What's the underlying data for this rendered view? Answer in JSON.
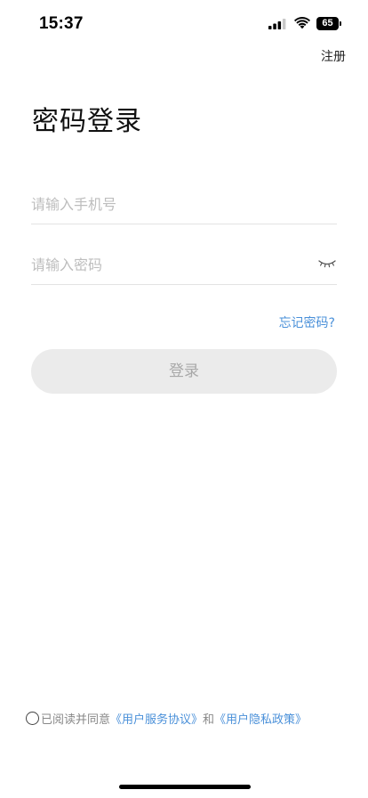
{
  "status_bar": {
    "time": "15:37",
    "battery_level": "65",
    "icons": [
      "signal-icon",
      "wifi-icon",
      "battery-icon"
    ]
  },
  "header": {
    "register_label": "注册"
  },
  "main": {
    "title": "密码登录",
    "phone_field": {
      "placeholder": "请输入手机号",
      "value": ""
    },
    "password_field": {
      "placeholder": "请输入密码",
      "value": "",
      "toggle_icon": "eye-closed-icon"
    },
    "forgot_password_label": "忘记密码?",
    "login_button_label": "登录"
  },
  "agreement": {
    "checked": false,
    "prefix": "已阅读并同意",
    "terms_link": "《用户服务协议》",
    "conjunction": "和",
    "privacy_link": "《用户隐私政策》"
  },
  "colors": {
    "link": "#4a90d9",
    "placeholder": "#bdbdbd",
    "button_bg": "#ebebeb",
    "button_text": "#a8a8a8",
    "divider": "#e3e3e3"
  }
}
